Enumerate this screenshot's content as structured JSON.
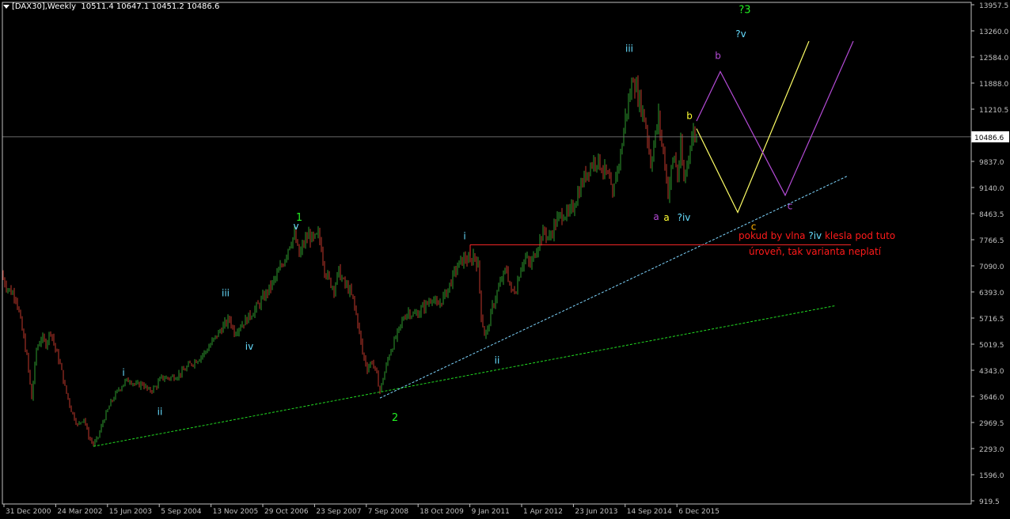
{
  "header": {
    "symbol": "[DAX30],Weekly",
    "ohlc": "10511.4 10647.1 10451.2 10486.6"
  },
  "colors": {
    "background": "#000000",
    "frame": "#c0c0c0",
    "grid": "#1f1f1f",
    "axis_text": "#c0c0c0",
    "candle_up": "#2e9a2e",
    "candle_down": "#c0392b",
    "price_line": "#6a6a6a",
    "green_trend": "#22dd22",
    "blue_trend": "#7fd6ff",
    "red_level": "#ff2a2a",
    "yellow_path": "#ffff66",
    "purple_path": "#b44bd6",
    "label_green": "#22ee22",
    "label_cyan": "#66ddff",
    "label_yellow": "#ffff33",
    "label_purple": "#b44bd6",
    "label_orange": "#ffb000",
    "label_red": "#ff1a1a"
  },
  "chart_data": {
    "type": "line",
    "title": "[DAX30],Weekly",
    "y_ticks": [
      "13957.5",
      "13260.0",
      "12584.0",
      "11888.0",
      "11210.5",
      "10486.6",
      "9837.0",
      "9140.0",
      "8463.5",
      "7766.5",
      "7090.0",
      "6393.0",
      "5716.5",
      "5019.5",
      "4343.0",
      "3646.0",
      "2969.5",
      "2293.0",
      "1596.0",
      "919.5"
    ],
    "x_ticks": [
      "31 Dec 2000",
      "24 Mar 2002",
      "15 Jun 2003",
      "5 Sep 2004",
      "13 Nov 2005",
      "29 Oct 2006",
      "23 Sep 2007",
      "7 Sep 2008",
      "18 Oct 2009",
      "9 Jan 2011",
      "1 Apr 2012",
      "23 Jun 2013",
      "14 Sep 2014",
      "6 Dec 2015"
    ],
    "ylim": [
      919.5,
      13957.5
    ],
    "x_range_index": [
      0,
      1276
    ],
    "current_price": "10486.6",
    "series": [
      {
        "name": "DAX30",
        "points": [
          [
            0,
            6900
          ],
          [
            10,
            6500
          ],
          [
            20,
            6300
          ],
          [
            28,
            5400
          ],
          [
            34,
            4700
          ],
          [
            40,
            3600
          ],
          [
            46,
            4900
          ],
          [
            52,
            5200
          ],
          [
            58,
            5050
          ],
          [
            64,
            5400
          ],
          [
            70,
            4900
          ],
          [
            76,
            4500
          ],
          [
            82,
            3900
          ],
          [
            90,
            3300
          ],
          [
            98,
            2900
          ],
          [
            106,
            3100
          ],
          [
            112,
            2600
          ],
          [
            118,
            2400
          ],
          [
            124,
            2600
          ],
          [
            130,
            3000
          ],
          [
            140,
            3500
          ],
          [
            150,
            3850
          ],
          [
            158,
            4050
          ],
          [
            164,
            4100
          ],
          [
            172,
            3950
          ],
          [
            180,
            4000
          ],
          [
            188,
            3800
          ],
          [
            196,
            3900
          ],
          [
            204,
            4150
          ],
          [
            214,
            4150
          ],
          [
            222,
            4200
          ],
          [
            230,
            4300
          ],
          [
            240,
            4500
          ],
          [
            250,
            4650
          ],
          [
            260,
            4850
          ],
          [
            270,
            5150
          ],
          [
            280,
            5450
          ],
          [
            290,
            5700
          ],
          [
            296,
            5350
          ],
          [
            302,
            5500
          ],
          [
            310,
            5650
          ],
          [
            318,
            5850
          ],
          [
            326,
            6050
          ],
          [
            334,
            6300
          ],
          [
            342,
            6550
          ],
          [
            350,
            6850
          ],
          [
            358,
            7200
          ],
          [
            366,
            7700
          ],
          [
            372,
            7900
          ],
          [
            378,
            7350
          ],
          [
            384,
            7700
          ],
          [
            390,
            7900
          ],
          [
            396,
            7750
          ],
          [
            402,
            7900
          ],
          [
            406,
            7600
          ],
          [
            410,
            7000
          ],
          [
            416,
            6700
          ],
          [
            422,
            6500
          ],
          [
            428,
            6950
          ],
          [
            434,
            6650
          ],
          [
            440,
            6500
          ],
          [
            446,
            6200
          ],
          [
            452,
            5600
          ],
          [
            458,
            4800
          ],
          [
            464,
            4400
          ],
          [
            470,
            4600
          ],
          [
            476,
            4200
          ],
          [
            480,
            3800
          ],
          [
            486,
            4300
          ],
          [
            492,
            4800
          ],
          [
            498,
            5100
          ],
          [
            504,
            5400
          ],
          [
            510,
            5750
          ],
          [
            516,
            5900
          ],
          [
            522,
            5800
          ],
          [
            528,
            5850
          ],
          [
            534,
            6000
          ],
          [
            540,
            6100
          ],
          [
            546,
            6300
          ],
          [
            552,
            6000
          ],
          [
            558,
            6200
          ],
          [
            564,
            6400
          ],
          [
            570,
            6700
          ],
          [
            576,
            7000
          ],
          [
            582,
            7200
          ],
          [
            588,
            7300
          ],
          [
            594,
            7150
          ],
          [
            598,
            7400
          ],
          [
            604,
            7100
          ],
          [
            608,
            5800
          ],
          [
            612,
            5300
          ],
          [
            616,
            5400
          ],
          [
            622,
            6000
          ],
          [
            628,
            6400
          ],
          [
            634,
            6750
          ],
          [
            640,
            7000
          ],
          [
            646,
            6400
          ],
          [
            652,
            6500
          ],
          [
            658,
            7100
          ],
          [
            664,
            7300
          ],
          [
            670,
            7100
          ],
          [
            676,
            7450
          ],
          [
            682,
            7800
          ],
          [
            688,
            8000
          ],
          [
            694,
            7800
          ],
          [
            700,
            8150
          ],
          [
            706,
            8350
          ],
          [
            712,
            8500
          ],
          [
            718,
            8400
          ],
          [
            724,
            8650
          ],
          [
            730,
            9000
          ],
          [
            736,
            9300
          ],
          [
            742,
            9600
          ],
          [
            748,
            9800
          ],
          [
            754,
            9900
          ],
          [
            760,
            9700
          ],
          [
            766,
            9500
          ],
          [
            770,
            9300
          ],
          [
            774,
            8800
          ],
          [
            778,
            9500
          ],
          [
            784,
            10000
          ],
          [
            790,
            11000
          ],
          [
            796,
            11600
          ],
          [
            800,
            12100
          ],
          [
            804,
            11700
          ],
          [
            810,
            11300
          ],
          [
            816,
            10800
          ],
          [
            822,
            9800
          ],
          [
            828,
            10500
          ],
          [
            832,
            11000
          ],
          [
            836,
            10300
          ],
          [
            840,
            9800
          ],
          [
            844,
            9000
          ],
          [
            848,
            9600
          ],
          [
            852,
            10000
          ],
          [
            856,
            9400
          ],
          [
            860,
            10200
          ],
          [
            864,
            9300
          ],
          [
            868,
            9800
          ],
          [
            872,
            10300
          ],
          [
            876,
            10600
          ],
          [
            880,
            10487
          ]
        ]
      }
    ],
    "trendlines": [
      {
        "color_key": "green_trend",
        "from": [
          118,
          2350
        ],
        "to": [
          1056,
          6050
        ]
      },
      {
        "color_key": "blue_trend",
        "from": [
          480,
          3620
        ],
        "to": [
          1070,
          9450
        ]
      },
      {
        "color_key": "red_level",
        "from": [
          594,
          7650
        ],
        "to": [
          1075,
          7650
        ]
      }
    ],
    "projections": [
      {
        "color_key": "yellow_path",
        "points": [
          [
            880,
            10700
          ],
          [
            932,
            8500
          ],
          [
            1022,
            13000
          ]
        ]
      },
      {
        "color_key": "purple_path",
        "points": [
          [
            880,
            10900
          ],
          [
            910,
            12200
          ],
          [
            992,
            8950
          ],
          [
            1078,
            13000
          ]
        ]
      }
    ],
    "annotations": [
      {
        "text": "1",
        "x": 378,
        "y": 8280,
        "color_key": "label_green",
        "size": 13
      },
      {
        "text": "2",
        "x": 499,
        "y": 3020,
        "color_key": "label_green",
        "size": 13
      },
      {
        "text": "?3",
        "x": 941,
        "y": 13740,
        "color_key": "label_green",
        "size": 13
      },
      {
        "text": "v",
        "x": 374,
        "y": 8050,
        "color_key": "label_cyan",
        "size": 12
      },
      {
        "text": "iii",
        "x": 285,
        "y": 6300,
        "color_key": "label_cyan",
        "size": 12
      },
      {
        "text": "iv",
        "x": 315,
        "y": 4890,
        "color_key": "label_cyan",
        "size": 12
      },
      {
        "text": "i",
        "x": 156,
        "y": 4210,
        "color_key": "label_cyan",
        "size": 12
      },
      {
        "text": "ii",
        "x": 202,
        "y": 3180,
        "color_key": "label_cyan",
        "size": 12
      },
      {
        "text": "i",
        "x": 587,
        "y": 7790,
        "color_key": "label_cyan",
        "size": 12
      },
      {
        "text": "ii",
        "x": 628,
        "y": 4530,
        "color_key": "label_cyan",
        "size": 12
      },
      {
        "text": "iii",
        "x": 795,
        "y": 12720,
        "color_key": "label_cyan",
        "size": 12
      },
      {
        "text": "?v",
        "x": 936,
        "y": 13100,
        "color_key": "label_cyan",
        "size": 12
      },
      {
        "text": "?iv",
        "x": 864,
        "y": 8280,
        "color_key": "label_cyan",
        "size": 12
      },
      {
        "text": "b",
        "x": 871,
        "y": 10950,
        "color_key": "label_yellow",
        "size": 12
      },
      {
        "text": "a",
        "x": 842,
        "y": 8280,
        "color_key": "label_yellow",
        "size": 12
      },
      {
        "text": "c",
        "x": 952,
        "y": 8040,
        "color_key": "label_orange",
        "size": 12
      },
      {
        "text": "a",
        "x": 829,
        "y": 8300,
        "color_key": "label_purple",
        "size": 12
      },
      {
        "text": "b",
        "x": 907,
        "y": 12530,
        "color_key": "label_purple",
        "size": 12
      },
      {
        "text": "c",
        "x": 998,
        "y": 8580,
        "color_key": "label_purple",
        "size": 12
      }
    ],
    "note": {
      "line1_a": "pokud by vlna ",
      "line1_b": "?iv",
      "line1_c": " klesla pod tuto",
      "line2": "úroveň, tak varianta neplatí"
    }
  }
}
